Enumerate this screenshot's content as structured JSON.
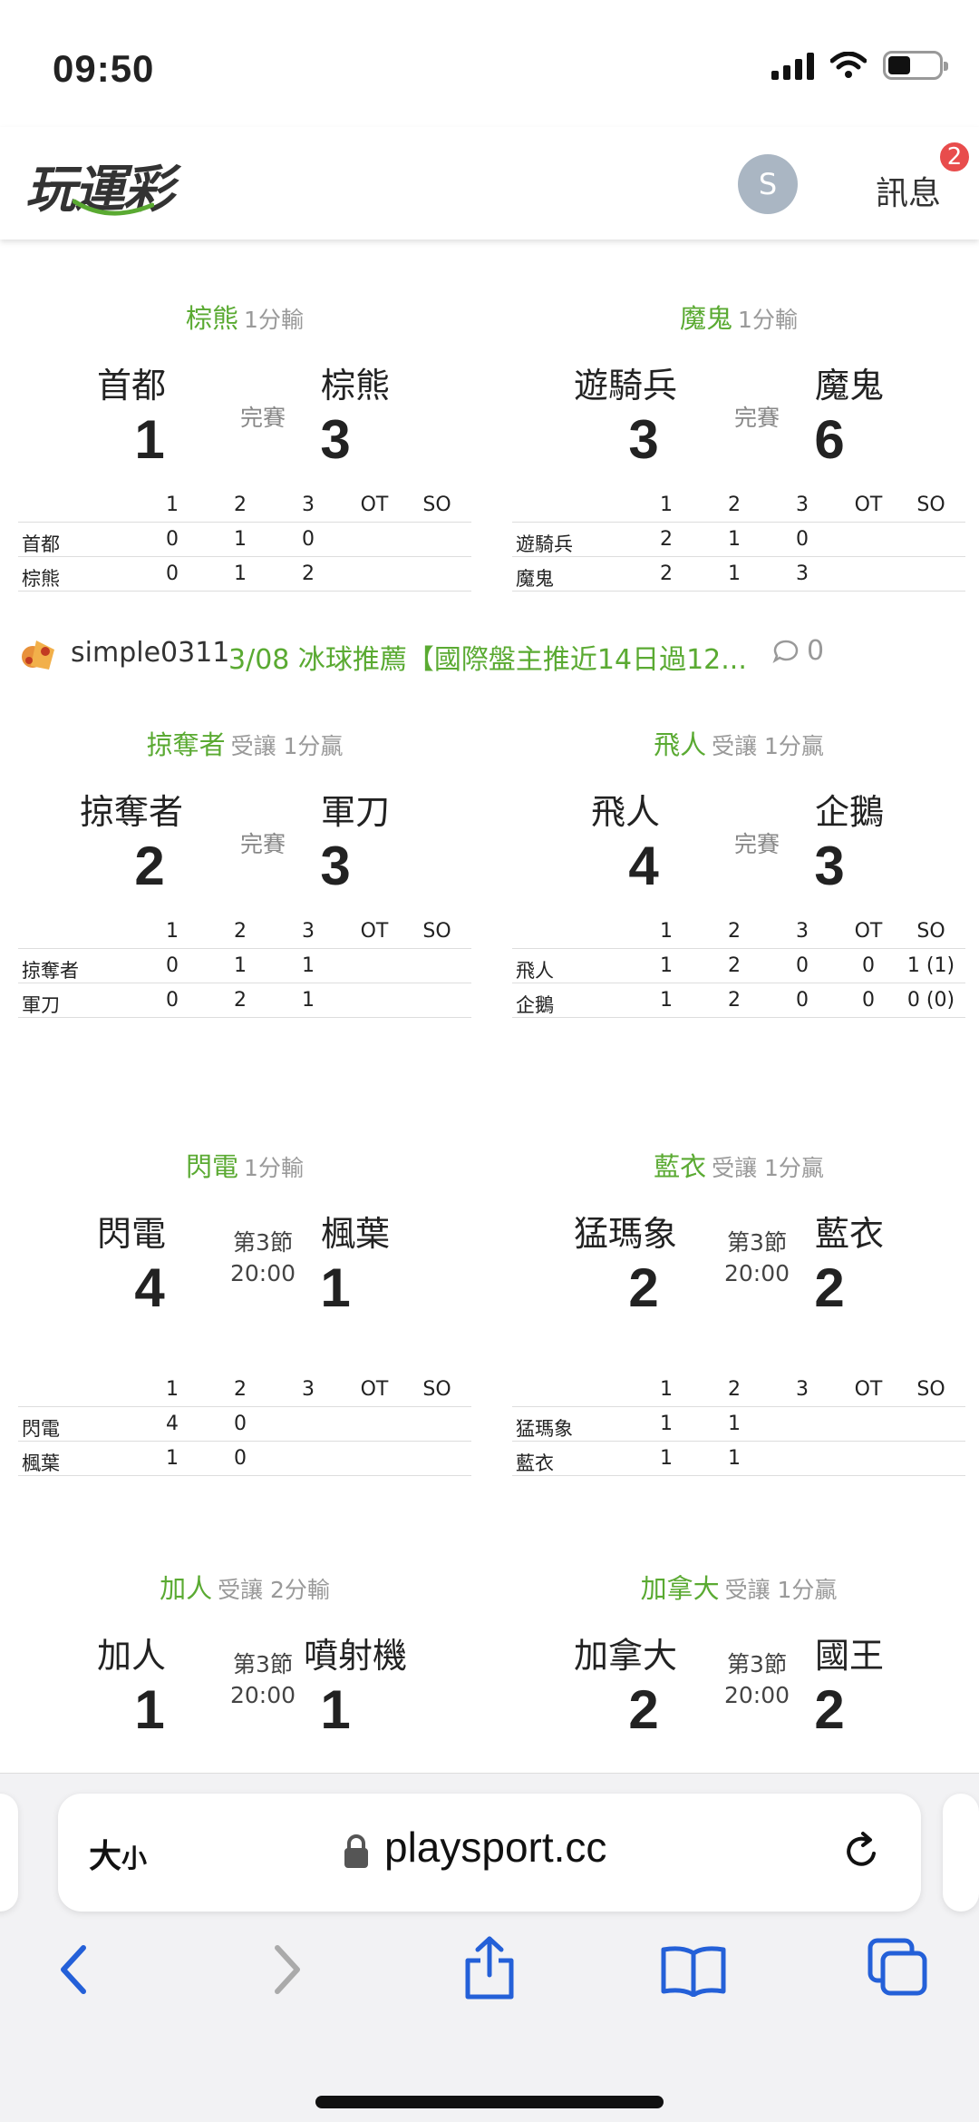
{
  "status_bar": {
    "time": "09:50"
  },
  "header": {
    "logo": "玩運彩",
    "avatar_letter": "S",
    "messages_label": "訊息",
    "messages_badge": "2"
  },
  "box_columns": [
    "1",
    "2",
    "3",
    "OT",
    "SO"
  ],
  "games": [
    {
      "pick_team": "棕熊",
      "pick_odds": "1分輸",
      "away": {
        "name": "首都",
        "score": "1",
        "periods": [
          "0",
          "1",
          "0",
          "",
          ""
        ]
      },
      "home": {
        "name": "棕熊",
        "score": "3",
        "periods": [
          "0",
          "1",
          "2",
          "",
          ""
        ]
      },
      "status": "完賽",
      "status_time": ""
    },
    {
      "pick_team": "魔鬼",
      "pick_odds": "1分輸",
      "away": {
        "name": "遊騎兵",
        "score": "3",
        "periods": [
          "2",
          "1",
          "0",
          "",
          ""
        ]
      },
      "home": {
        "name": "魔鬼",
        "score": "6",
        "periods": [
          "2",
          "1",
          "3",
          "",
          ""
        ]
      },
      "status": "完賽",
      "status_time": ""
    },
    {
      "pick_team": "掠奪者",
      "pick_odds": "受讓 1分贏",
      "away": {
        "name": "掠奪者",
        "score": "2",
        "periods": [
          "0",
          "1",
          "1",
          "",
          ""
        ]
      },
      "home": {
        "name": "軍刀",
        "score": "3",
        "periods": [
          "0",
          "2",
          "1",
          "",
          ""
        ]
      },
      "status": "完賽",
      "status_time": ""
    },
    {
      "pick_team": "飛人",
      "pick_odds": "受讓 1分贏",
      "away": {
        "name": "飛人",
        "score": "4",
        "periods": [
          "1",
          "2",
          "0",
          "0",
          "1 (1)"
        ]
      },
      "home": {
        "name": "企鵝",
        "score": "3",
        "periods": [
          "1",
          "2",
          "0",
          "0",
          "0 (0)"
        ]
      },
      "status": "完賽",
      "status_time": ""
    },
    {
      "pick_team": "閃電",
      "pick_odds": "1分輸",
      "away": {
        "name": "閃電",
        "score": "4",
        "periods": [
          "4",
          "0",
          "",
          "",
          ""
        ]
      },
      "home": {
        "name": "楓葉",
        "score": "1",
        "periods": [
          "1",
          "0",
          "",
          "",
          ""
        ]
      },
      "status": "第3節",
      "status_time": "20:00"
    },
    {
      "pick_team": "藍衣",
      "pick_odds": "受讓 1分贏",
      "away": {
        "name": "猛瑪象",
        "score": "2",
        "periods": [
          "1",
          "1",
          "",
          "",
          ""
        ]
      },
      "home": {
        "name": "藍衣",
        "score": "2",
        "periods": [
          "1",
          "1",
          "",
          "",
          ""
        ]
      },
      "status": "第3節",
      "status_time": "20:00"
    },
    {
      "pick_team": "加人",
      "pick_odds": "受讓 2分輸",
      "away": {
        "name": "加人",
        "score": "1",
        "periods": [
          "",
          "",
          "",
          "",
          ""
        ]
      },
      "home": {
        "name": "噴射機",
        "score": "1",
        "periods": [
          "",
          "",
          "",
          "",
          ""
        ]
      },
      "status": "第3節",
      "status_time": "20:00"
    },
    {
      "pick_team": "加拿大",
      "pick_odds": "受讓 1分贏",
      "away": {
        "name": "加拿大",
        "score": "2",
        "periods": [
          "",
          "",
          "",
          "",
          ""
        ]
      },
      "home": {
        "name": "國王",
        "score": "2",
        "periods": [
          "",
          "",
          "",
          "",
          ""
        ]
      },
      "status": "第3節",
      "status_time": "20:00"
    }
  ],
  "post": {
    "user": "simple0311",
    "title": "3/08 冰球推薦【國際盤主推近14日過12...",
    "comments": "0"
  },
  "browser": {
    "text_size": "大",
    "text_size_small": "小",
    "url": "playsport.cc"
  }
}
